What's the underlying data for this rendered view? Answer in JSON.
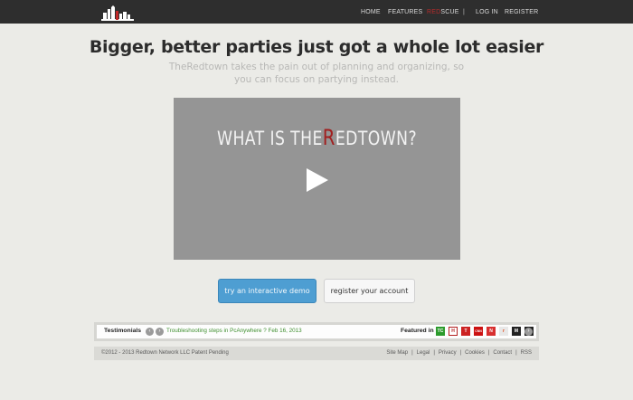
{
  "nav": {
    "home": "HOME",
    "features": "FEATURES",
    "rescue_red": "RED",
    "rescue_rest": "SCUE",
    "separator": "|",
    "login": "LOG IN",
    "register": "REGISTER"
  },
  "hero": {
    "headline": "Bigger, better parties just got a whole lot easier",
    "subline": "TheRedtown takes the pain out of planning and organizing, so you can focus on partying instead."
  },
  "video": {
    "title_pre": "WHAT IS THE",
    "title_r": "R",
    "title_post": "EDTOWN?"
  },
  "buttons": {
    "demo": "try an interactive demo",
    "register": "register your account"
  },
  "testimonials": {
    "label": "Testimonials",
    "prev": "‹",
    "next": "›",
    "text": "Troubleshooting steps in PcAnywhere ? Feb 16, 2013",
    "featured_label": "Featured in",
    "press_logos": [
      {
        "name": "techcrunch-logo",
        "text": "TC",
        "color": "#2c9b2c"
      },
      {
        "name": "hn-logo",
        "text": "H",
        "color": "#ffffff"
      },
      {
        "name": "t-logo",
        "text": "T",
        "color": "#cc2222"
      },
      {
        "name": "cnn-logo",
        "text": "CNN",
        "color": "#cc1111"
      },
      {
        "name": "feed-logo",
        "text": "N",
        "color": "#d83030"
      },
      {
        "name": "reddit-logo",
        "text": "r",
        "color": "#e8e8e8"
      },
      {
        "name": "mashable-logo",
        "text": "M",
        "color": "#222222"
      },
      {
        "name": "fb-logo",
        "text": "Fb",
        "color": "#222222"
      }
    ]
  },
  "footer": {
    "copyright": "©2012 - 2013 Redtown Network LLC Patent Pending",
    "links": [
      "Site Map",
      "|",
      "Legal",
      "|",
      "Privacy",
      "|",
      "Cookies",
      "|",
      "Contact",
      "|",
      "RSS"
    ]
  }
}
